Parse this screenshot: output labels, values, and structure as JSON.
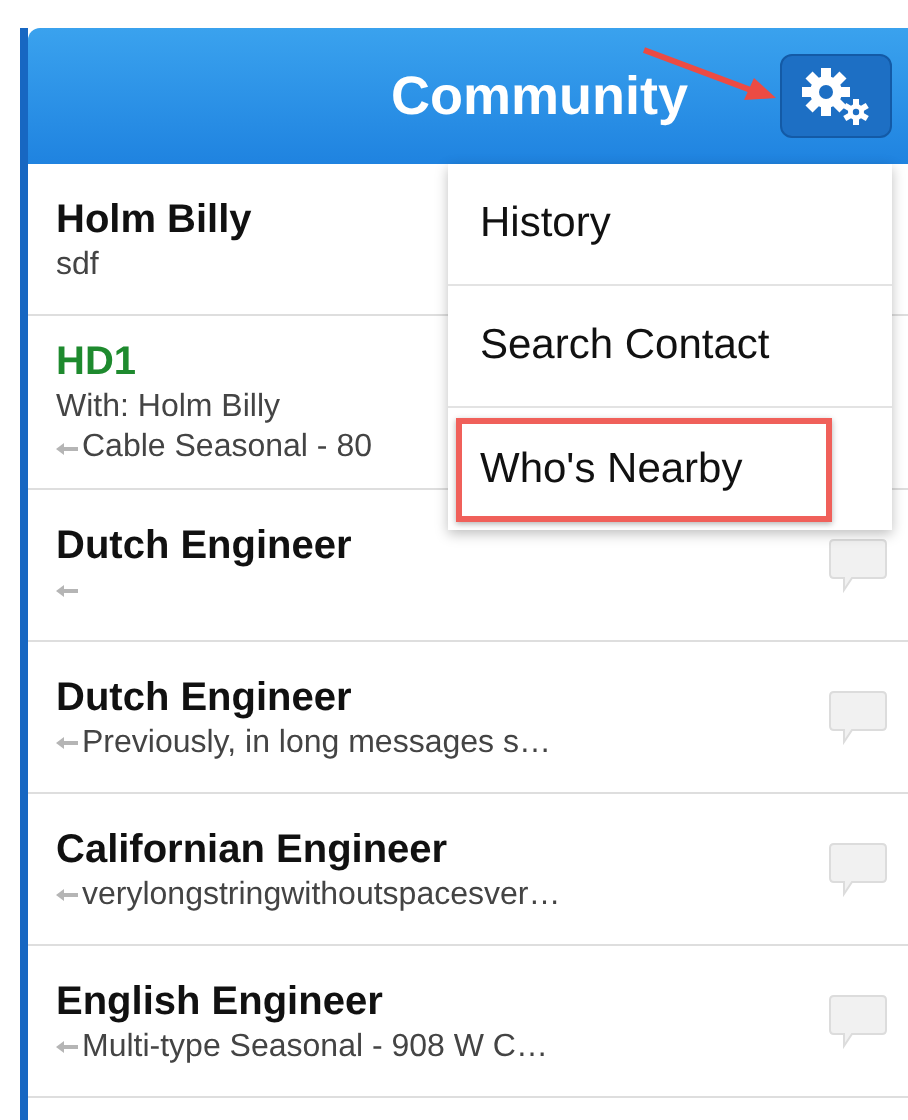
{
  "header": {
    "title": "Community"
  },
  "contacts": [
    {
      "name": "Holm Billy",
      "color": "#111111",
      "lines": [
        {
          "kind": "text",
          "text": "sdf"
        }
      ]
    },
    {
      "name": "HD1",
      "color": "#1e8a2e",
      "lines": [
        {
          "kind": "text",
          "text": "With: Holm Billy"
        },
        {
          "kind": "message",
          "text": "Cable Seasonal - 80"
        }
      ]
    },
    {
      "name": "Dutch Engineer",
      "color": "#111111",
      "lines": [
        {
          "kind": "message"
        }
      ],
      "bubble": true
    },
    {
      "name": "Dutch Engineer",
      "color": "#111111",
      "lines": [
        {
          "kind": "message",
          "text": "Previously, in long messages s…"
        }
      ],
      "bubble": true
    },
    {
      "name": "Californian Engineer",
      "color": "#111111",
      "lines": [
        {
          "kind": "message",
          "text": "verylongstringwithoutspacesver…"
        }
      ],
      "bubble": true
    },
    {
      "name": "English Engineer",
      "color": "#111111",
      "lines": [
        {
          "kind": "message",
          "text": "Multi-type Seasonal - 908 W C…"
        }
      ],
      "bubble": true
    }
  ],
  "menu": {
    "items": [
      {
        "label": "History",
        "highlighted": false
      },
      {
        "label": "Search Contact",
        "highlighted": false
      },
      {
        "label": "Who's Nearby",
        "highlighted": true
      }
    ]
  }
}
